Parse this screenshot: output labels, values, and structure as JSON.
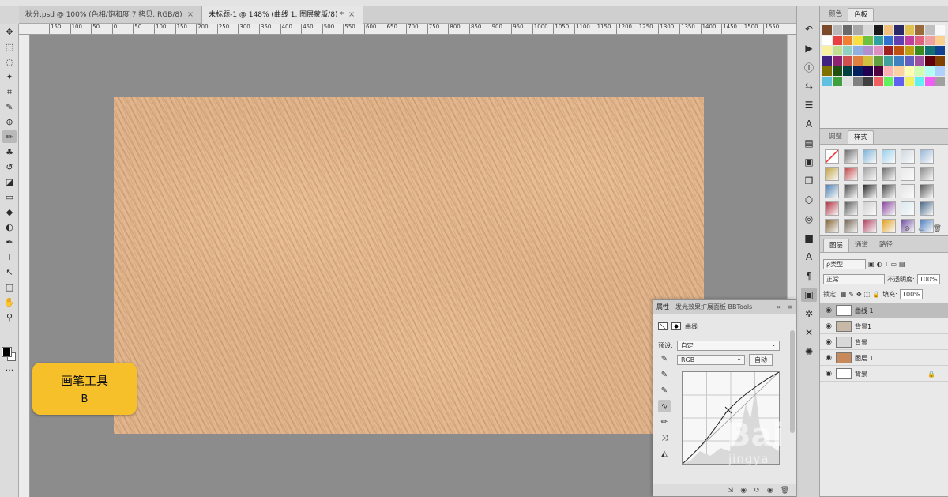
{
  "doc_tabs": [
    {
      "label": "秋分.psd @ 100% (色相/饱和度 7 拷贝, RGB/8)",
      "close": "×",
      "active": false
    },
    {
      "label": "未标题-1 @ 148% (曲线 1, 图层蒙版/8) *",
      "close": "×",
      "active": true
    }
  ],
  "ruler_ticks": [
    "150",
    "100",
    "50",
    "0",
    "50",
    "100",
    "150",
    "200",
    "250",
    "300",
    "350",
    "400",
    "450",
    "500",
    "550",
    "600",
    "650",
    "700",
    "750",
    "800",
    "850",
    "900",
    "950",
    "1000",
    "1050",
    "1100",
    "1150",
    "1200",
    "1250",
    "1300",
    "1350",
    "1400",
    "1450",
    "1500",
    "1550"
  ],
  "toolbar": {
    "icons": [
      "move-icon",
      "marquee-icon",
      "lasso-icon",
      "magic-wand-icon",
      "crop-icon",
      "eyedropper-icon",
      "healing-icon",
      "brush-icon",
      "stamp-icon",
      "history-brush-icon",
      "eraser-icon",
      "gradient-icon",
      "blur-icon",
      "dodge-icon",
      "pen-icon",
      "type-icon",
      "path-select-icon",
      "rectangle-icon",
      "hand-icon",
      "zoom-icon",
      "more-icon"
    ],
    "glyphs": [
      "✥",
      "⬚",
      "◌",
      "✦",
      "⌗",
      "✎",
      "⊕",
      "✏",
      "♣",
      "↺",
      "◪",
      "▭",
      "◆",
      "◐",
      "✒",
      "T",
      "↖",
      "□",
      "✋",
      "⚲",
      "···"
    ],
    "active_index": 7
  },
  "badge": {
    "line1": "画笔工具",
    "line2": "B"
  },
  "side_icons": [
    "↶",
    "▶",
    "ⓘ",
    "⇆",
    "☰",
    "A",
    "▤",
    "▣",
    "❒",
    "⬡",
    "◎",
    "▆",
    "A",
    "¶",
    "▣",
    "✲",
    "✕",
    "✺"
  ],
  "swatches_panel": {
    "tabs": [
      {
        "label": "颜色",
        "active": false
      },
      {
        "label": "色板",
        "active": true
      }
    ]
  },
  "swatch_colors": [
    "#7a4a2a",
    "#b9b9b9",
    "#6a6a6a",
    "#a8a8a8",
    "#d8d8d8",
    "#1a1a1a",
    "#f0c080",
    "#2a2a6a",
    "#e0c050",
    "#9a6a3a",
    "#c0c0c0",
    "#f8f8f8",
    "#ffffff",
    "#e84040",
    "#f08030",
    "#f8e040",
    "#70c040",
    "#30a0a0",
    "#3070d0",
    "#6040b0",
    "#c040a0",
    "#e06080",
    "#f0a0a0",
    "#f8d090",
    "#f8f0a0",
    "#c0e090",
    "#90d0c0",
    "#90b0e0",
    "#b090d0",
    "#e090c0",
    "#a02020",
    "#c05010",
    "#c0a010",
    "#3a8a20",
    "#107070",
    "#104090",
    "#402080",
    "#902070",
    "#d05050",
    "#e08040",
    "#d0c040",
    "#60a040",
    "#40a0a0",
    "#4080c0",
    "#6060c0",
    "#a050a0",
    "#600010",
    "#804000",
    "#807000",
    "#205010",
    "#004040",
    "#002060",
    "#200050",
    "#500040",
    "#ffb0b0",
    "#ffd0a0",
    "#ffffb0",
    "#d0ffb0",
    "#b0fff0",
    "#b0d0ff",
    "#60c0e0",
    "#40a040",
    "#e0e0e0",
    "#808080",
    "#404040",
    "#f06060",
    "#60f060",
    "#6060f0",
    "#f0f060",
    "#60f0f0",
    "#f060f0",
    "#a0a0a0"
  ],
  "adjust_panel": {
    "tabs": [
      {
        "label": "调整",
        "active": false
      },
      {
        "label": "样式",
        "active": true
      }
    ]
  },
  "style_colors": [
    "#f4f4f4",
    "#6a6a6a",
    "#7fb4d8",
    "#9ad0ea",
    "#cfd8e0",
    "#9ab8d8",
    "#c0a040",
    "#c04040",
    "#a0a0a0",
    "#6a6a6a",
    "#e8e8e8",
    "#8a8a8a",
    "#4a7fb0",
    "#4a4a4a",
    "#2a2a2a",
    "#4a4a4a",
    "#e4e4e4",
    "#5a5a5a",
    "#b03040",
    "#5a5a5a",
    "#d0d0d0",
    "#8a4aa0",
    "#d8e8f0",
    "#4a6a8a",
    "#806030",
    "#706050",
    "#b04060",
    "#e0a020",
    "#7050a0",
    "#5080c0"
  ],
  "adjust_foot": [
    "⊘",
    "▭",
    "🗑"
  ],
  "layers_panel": {
    "tabs": [
      {
        "label": "图层",
        "active": true
      },
      {
        "label": "通道",
        "active": false
      },
      {
        "label": "路径",
        "active": false
      }
    ],
    "kind_filter": "ρ类型",
    "filter_icons": [
      "▣",
      "◐",
      "T",
      "▭",
      "▤"
    ],
    "blend_mode": "正常",
    "opacity_label": "不透明度:",
    "opacity_value": "100%",
    "lock_label": "锁定:",
    "lock_icons": [
      "▦",
      "✎",
      "✥",
      "⬚",
      "🔒"
    ],
    "fill_label": "填充:",
    "fill_value": "100%",
    "layers": [
      {
        "name": "曲线 1",
        "thumb": "#ffffff",
        "selected": true,
        "lock": ""
      },
      {
        "name": "背景1",
        "thumb": "#c8b8a8",
        "selected": false,
        "lock": ""
      },
      {
        "name": "背景",
        "thumb": "#d8d8d8",
        "selected": false,
        "lock": ""
      },
      {
        "name": "图层 1",
        "thumb": "#c88a5a",
        "selected": false,
        "lock": ""
      },
      {
        "name": "背景",
        "thumb": "#ffffff",
        "selected": false,
        "lock": "🔒"
      }
    ]
  },
  "props_panel": {
    "tabs": [
      "属性",
      "发光效果扩展面板 BBTools"
    ],
    "collapse": "»",
    "menu": "≡",
    "mode_label": "曲线",
    "preset_label": "预设:",
    "preset_value": "自定",
    "channel_value": "RGB",
    "auto_button": "自动",
    "curve_tools": [
      "✎",
      "✎",
      "✎",
      "∿",
      "✏",
      "⤨",
      "◭"
    ],
    "foot_icons": [
      "⇲",
      "◉",
      "↺",
      "◉",
      "🗑"
    ]
  },
  "watermark": {
    "big": "Bai",
    "small": "jingya"
  }
}
